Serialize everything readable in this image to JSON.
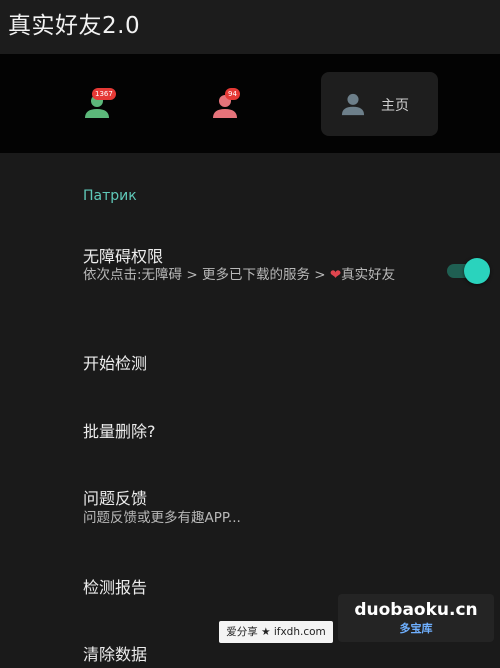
{
  "app": {
    "title": "真实好友2.0"
  },
  "nav": {
    "items": [
      {
        "badge": "1367",
        "icon": "person-green-icon"
      },
      {
        "badge": "94",
        "icon": "person-red-icon"
      },
      {
        "label": "主页",
        "icon": "person-gray-icon"
      }
    ]
  },
  "section": {
    "header": "Патрик"
  },
  "settings": {
    "accessibility": {
      "title": "无障碍权限",
      "subtitle_prefix": "依次点击:无障碍 > 更多已下载的服务 > ",
      "heart": "❤",
      "subtitle_suffix": "真实好友",
      "toggle_on": true
    },
    "start_detection": {
      "title": "开始检测"
    },
    "batch_delete": {
      "title": "批量删除?"
    },
    "feedback": {
      "title": "问题反馈",
      "subtitle": "问题反馈或更多有趣APP..."
    },
    "report": {
      "title": "检测报告"
    },
    "clear_data": {
      "title": "清除数据"
    }
  },
  "watermarks": {
    "left": "爱分享 ★ ifxdh.com",
    "right_main": "duobaoku.cn",
    "right_sub": "多宝库"
  },
  "colors": {
    "accent": "#2ad3bd",
    "section_header": "#5fc9b9",
    "badge": "#e53935",
    "person_green": "#5cb87a",
    "person_red": "#e5737a",
    "person_gray": "#6d7f8a"
  }
}
